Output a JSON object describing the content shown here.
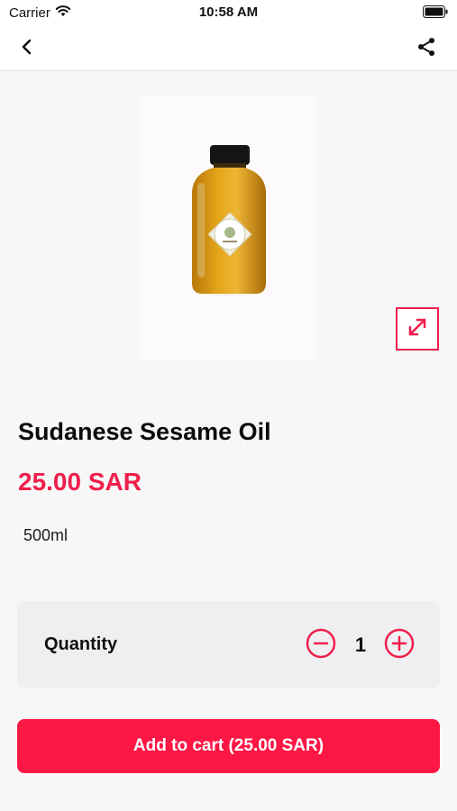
{
  "status_bar": {
    "carrier": "Carrier",
    "time": "10:58 AM",
    "icons": [
      "wifi-icon",
      "battery-icon"
    ]
  },
  "nav": {
    "back_icon": "chevron-left-icon",
    "share_icon": "share-icon"
  },
  "product": {
    "image_icon": "product-photo-oil-bottle",
    "expand_icon": "expand-arrows-icon",
    "title": "Sudanese Sesame Oil",
    "price": "25.00 SAR",
    "variant": "500ml"
  },
  "quantity": {
    "label": "Quantity",
    "value": "1",
    "minus_icon": "minus-circle-icon",
    "plus_icon": "plus-circle-icon"
  },
  "cart_button": {
    "label": "Add to cart (25.00 SAR)"
  },
  "colors": {
    "accent": "#ef1f4b",
    "button": "#fc1745",
    "background": "#f7f7f8",
    "card": "#efeff1"
  }
}
